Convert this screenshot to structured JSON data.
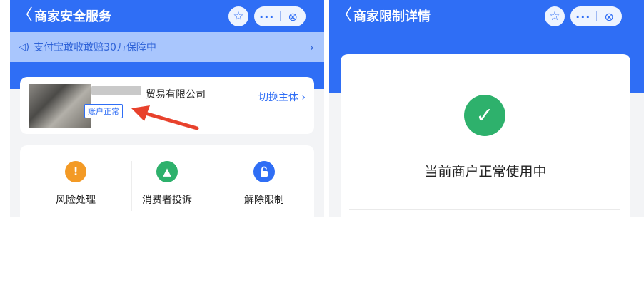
{
  "left_screen": {
    "nav": {
      "back_icon": "chevron-left-icon",
      "title": "商家安全服务",
      "favorite_icon": "☆",
      "more_icon": "···",
      "close_icon": "⊗"
    },
    "notice": {
      "icon": "speaker-icon",
      "text": "支付宝敢收敢赔30万保障中",
      "chevron": "›"
    },
    "merchant": {
      "company_name": "贸易有限公司",
      "status_tag": "账户正常",
      "switch_label": "切换主体",
      "switch_chevron": "›"
    },
    "services": [
      {
        "label": "风险处理",
        "icon": "shield-warning-icon",
        "glyph": "!",
        "color": "#f39a25"
      },
      {
        "label": "消费者投诉",
        "icon": "alarm-icon",
        "glyph": "▲",
        "color": "#2eb16c"
      },
      {
        "label": "解除限制",
        "icon": "unlock-icon",
        "glyph": "🔓",
        "color": "#2f6ef5"
      }
    ]
  },
  "right_screen": {
    "nav": {
      "back_icon": "chevron-left-icon",
      "title": "商家限制详情",
      "favorite_icon": "☆",
      "more_icon": "···",
      "close_icon": "⊗"
    },
    "status": {
      "icon": "check-circle-icon",
      "glyph": "✓",
      "text": "当前商户正常使用中"
    }
  },
  "colors": {
    "header_blue": "#2f6ef5",
    "notice_bg": "#a9c6fd",
    "success_green": "#2eb16c",
    "warning_orange": "#f39a25",
    "annotation_red": "#e8412c"
  }
}
